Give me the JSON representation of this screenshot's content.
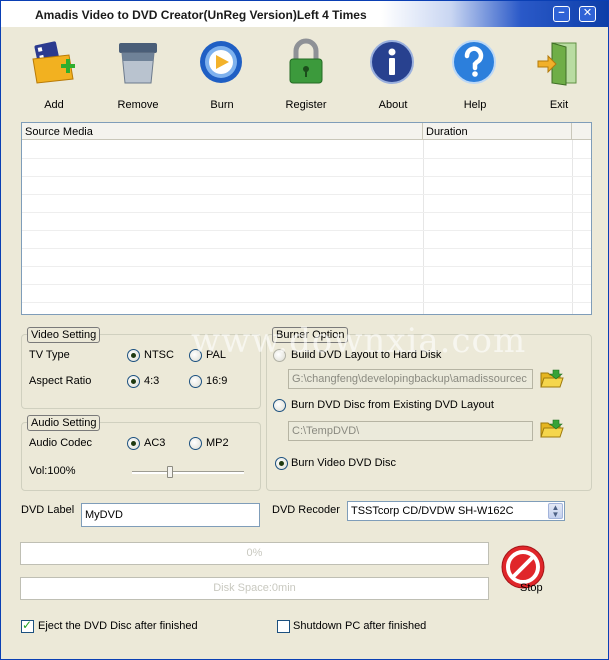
{
  "window": {
    "title": "Amadis Video to DVD Creator(UnReg Version)Left 4 Times",
    "minimize_glyph": "−",
    "close_glyph": "✕"
  },
  "toolbar": [
    {
      "id": "add",
      "label": "Add",
      "icon": "film-add-icon"
    },
    {
      "id": "remove",
      "label": "Remove",
      "icon": "trash-icon"
    },
    {
      "id": "burn",
      "label": "Burn",
      "icon": "disc-play-icon"
    },
    {
      "id": "register",
      "label": "Register",
      "icon": "padlock-icon"
    },
    {
      "id": "about",
      "label": "About",
      "icon": "info-icon"
    },
    {
      "id": "help",
      "label": "Help",
      "icon": "help-icon"
    },
    {
      "id": "exit",
      "label": "Exit",
      "icon": "exit-door-icon"
    }
  ],
  "media_list": {
    "columns": [
      "Source Media",
      "Duration"
    ],
    "rows": []
  },
  "video_setting": {
    "title": "Video Setting",
    "tv_type_label": "TV Type",
    "tv_type_options": [
      "NTSC",
      "PAL"
    ],
    "tv_type_selected": "NTSC",
    "aspect_label": "Aspect Ratio",
    "aspect_options": [
      "4:3",
      "16:9"
    ],
    "aspect_selected": "4:3"
  },
  "audio_setting": {
    "title": "Audio Setting",
    "codec_label": "Audio Codec",
    "codec_options": [
      "AC3",
      "MP2"
    ],
    "codec_selected": "AC3",
    "volume_label": "Vol:100%",
    "volume": 1.0
  },
  "burner_option": {
    "title": "Burner Option",
    "option_build": "Build DVD Layout to Hard Disk",
    "build_path": "G:\\changfeng\\developingbackup\\amadissourcec",
    "option_existing": "Burn DVD Disc from Existing DVD Layout",
    "existing_path": "C:\\TempDVD\\",
    "option_video": "Burn Video DVD Disc",
    "selected": "Burn Video DVD Disc"
  },
  "dvd_label": {
    "label": "DVD Label",
    "value": "MyDVD"
  },
  "dvd_recorder": {
    "label": "DVD Recoder",
    "value": "TSSTcorp CD/DVDW SH-W162C"
  },
  "progress": {
    "percent_text": "0%",
    "percent": 0,
    "disk_space_text": "Disk Space:0min"
  },
  "stop_button": {
    "label": "Stop",
    "icon": "stop-icon"
  },
  "options": {
    "eject_label": "Eject the DVD Disc after finished",
    "eject_checked": true,
    "shutdown_label": "Shutdown PC after finished",
    "shutdown_checked": false
  },
  "watermark": "www.downxia.com",
  "colors": {
    "window_bg": "#ece9d8",
    "title_blue": "#0d3ea8",
    "stop_red": "#e0262a"
  }
}
